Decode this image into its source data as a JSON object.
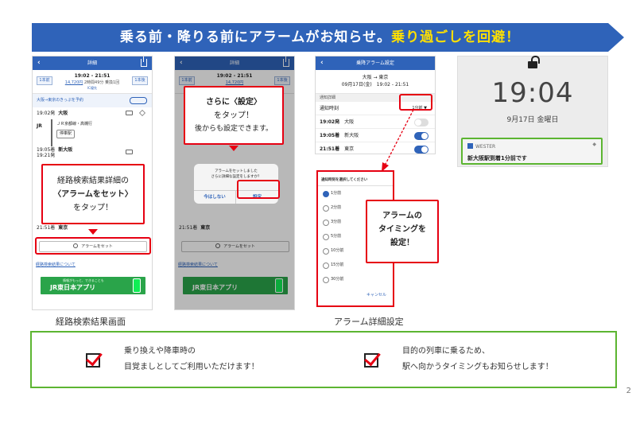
{
  "banner": {
    "text_white": "乗る前・降りる前にアラームがお知らせ。",
    "text_yellow": "乗り過ごしを回避！",
    "color": "#2f63b9",
    "highlight_color": "#ffe000"
  },
  "phone1": {
    "nav_title": "詳細",
    "prev_label": "1本前",
    "next_label": "1本後",
    "time_range": "19:02 - 21:51",
    "fare": "14,720円",
    "duration": "2時間49分",
    "transfers": "乗換1回",
    "ic": "IC優先",
    "route_head": "大阪→東京のきっぷを予約",
    "stop1_time": "19:02発",
    "stop1_name": "大阪",
    "train_name": "ＪＲ京都線・高槻行",
    "train_platform": "停車駅",
    "stop2_time": "19:05着",
    "stop2_time2": "19:21発",
    "stop2_name": "新大阪",
    "stop3_time": "21:51着",
    "stop3_name": "東京",
    "alarm_button": "アラームをセット",
    "about_link": "経路検索結果について",
    "app_banner_small": "情報がもっと、できることも",
    "app_banner": "JR東日本アプリ"
  },
  "phone2": {
    "nav_title": "詳細",
    "dialog_msg1": "アラームをセットしました",
    "dialog_msg2": "さらに詳細な設定をしますか？",
    "btn_no": "今はしない",
    "btn_yes": "設定",
    "alarm_button": "アラームをセット",
    "about_link": "経路検索結果について",
    "app_banner": "JR東日本アプリ",
    "stop_time": "21:51着",
    "stop_name": "東京"
  },
  "callout1": {
    "line1": "経路検索結果詳細の",
    "line2": "〈アラームをセット〉",
    "line3": "をタップ！"
  },
  "callout2": {
    "line1": "さらに〈設定〉",
    "line2": "をタップ！",
    "line3": "後からも設定できます。"
  },
  "callout3": {
    "line1": "アラームの",
    "line2": "タイミングを",
    "line3": "設定！"
  },
  "phone3": {
    "nav_title": "乗降アラーム設定",
    "route": "大阪 → 東京",
    "datetime": "09月17日(金)　19:02 - 21:51",
    "section": "通知詳細",
    "timing_label": "通知時刻",
    "timing_value": "1分前 ▼",
    "rows": [
      {
        "time": "19:02発",
        "station": "大阪",
        "on": false
      },
      {
        "time": "19:05着",
        "station": "新大阪",
        "on": true
      },
      {
        "time": "21:51着",
        "station": "東京",
        "on": true
      }
    ]
  },
  "picker": {
    "header": "通知時刻を選択してください",
    "options": [
      "1分前",
      "2分前",
      "3分前",
      "5分前",
      "10分前",
      "15分前",
      "30分前"
    ],
    "selected_index": 0,
    "cancel": "キャンセル"
  },
  "lock": {
    "time": "19:04",
    "date": "9月17日 金曜日",
    "notif_app": "WESTER",
    "notif_msg": "新大阪駅到着1分前です"
  },
  "captions": {
    "left": "経路検索結果画面",
    "right": "アラーム詳細設定"
  },
  "info": {
    "left_line1": "乗り換えや降車時の",
    "left_line2": "目覚ましとしてご利用いただけます！",
    "right_line1": "目的の列車に乗るため、",
    "right_line2": "駅へ向かうタイミングもお知らせします！"
  },
  "page_number": "2"
}
